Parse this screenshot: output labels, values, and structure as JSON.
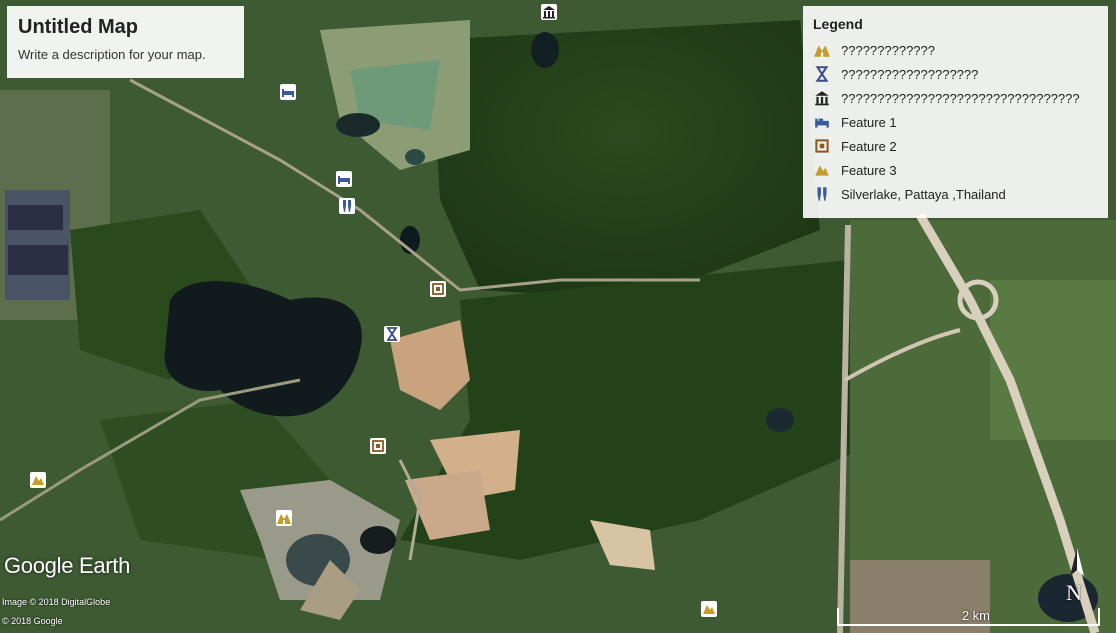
{
  "title_card": {
    "title": "Untitled Map",
    "description": "Write a description for your map."
  },
  "legend": {
    "heading": "Legend",
    "items": [
      {
        "label": "?????????????",
        "icon": "tent-icon",
        "color": "#c89a2a"
      },
      {
        "label": "???????????????????",
        "icon": "hourglass-icon",
        "color": "#3b4b8a"
      },
      {
        "label": "?????????????????????????????????",
        "icon": "museum-icon",
        "color": "#222222"
      },
      {
        "label": "Feature 1",
        "icon": "bed-icon",
        "color": "#3a5aa0"
      },
      {
        "label": "Feature 2",
        "icon": "square-pin-icon",
        "color": "#8a5a20"
      },
      {
        "label": "Feature 3",
        "icon": "hiker-icon",
        "color": "#c89a2a"
      },
      {
        "label": "Silverlake, Pattaya ,Thailand",
        "icon": "wine-icon",
        "color": "#3a5aa0"
      }
    ]
  },
  "branding": {
    "logo_left": "Google",
    "logo_right": "Earth",
    "credit_imagery": "Image © 2018 DigitalGlobe",
    "credit_google": "© 2018 Google"
  },
  "scale": {
    "label": "2 km"
  },
  "compass": {
    "label": "N"
  }
}
